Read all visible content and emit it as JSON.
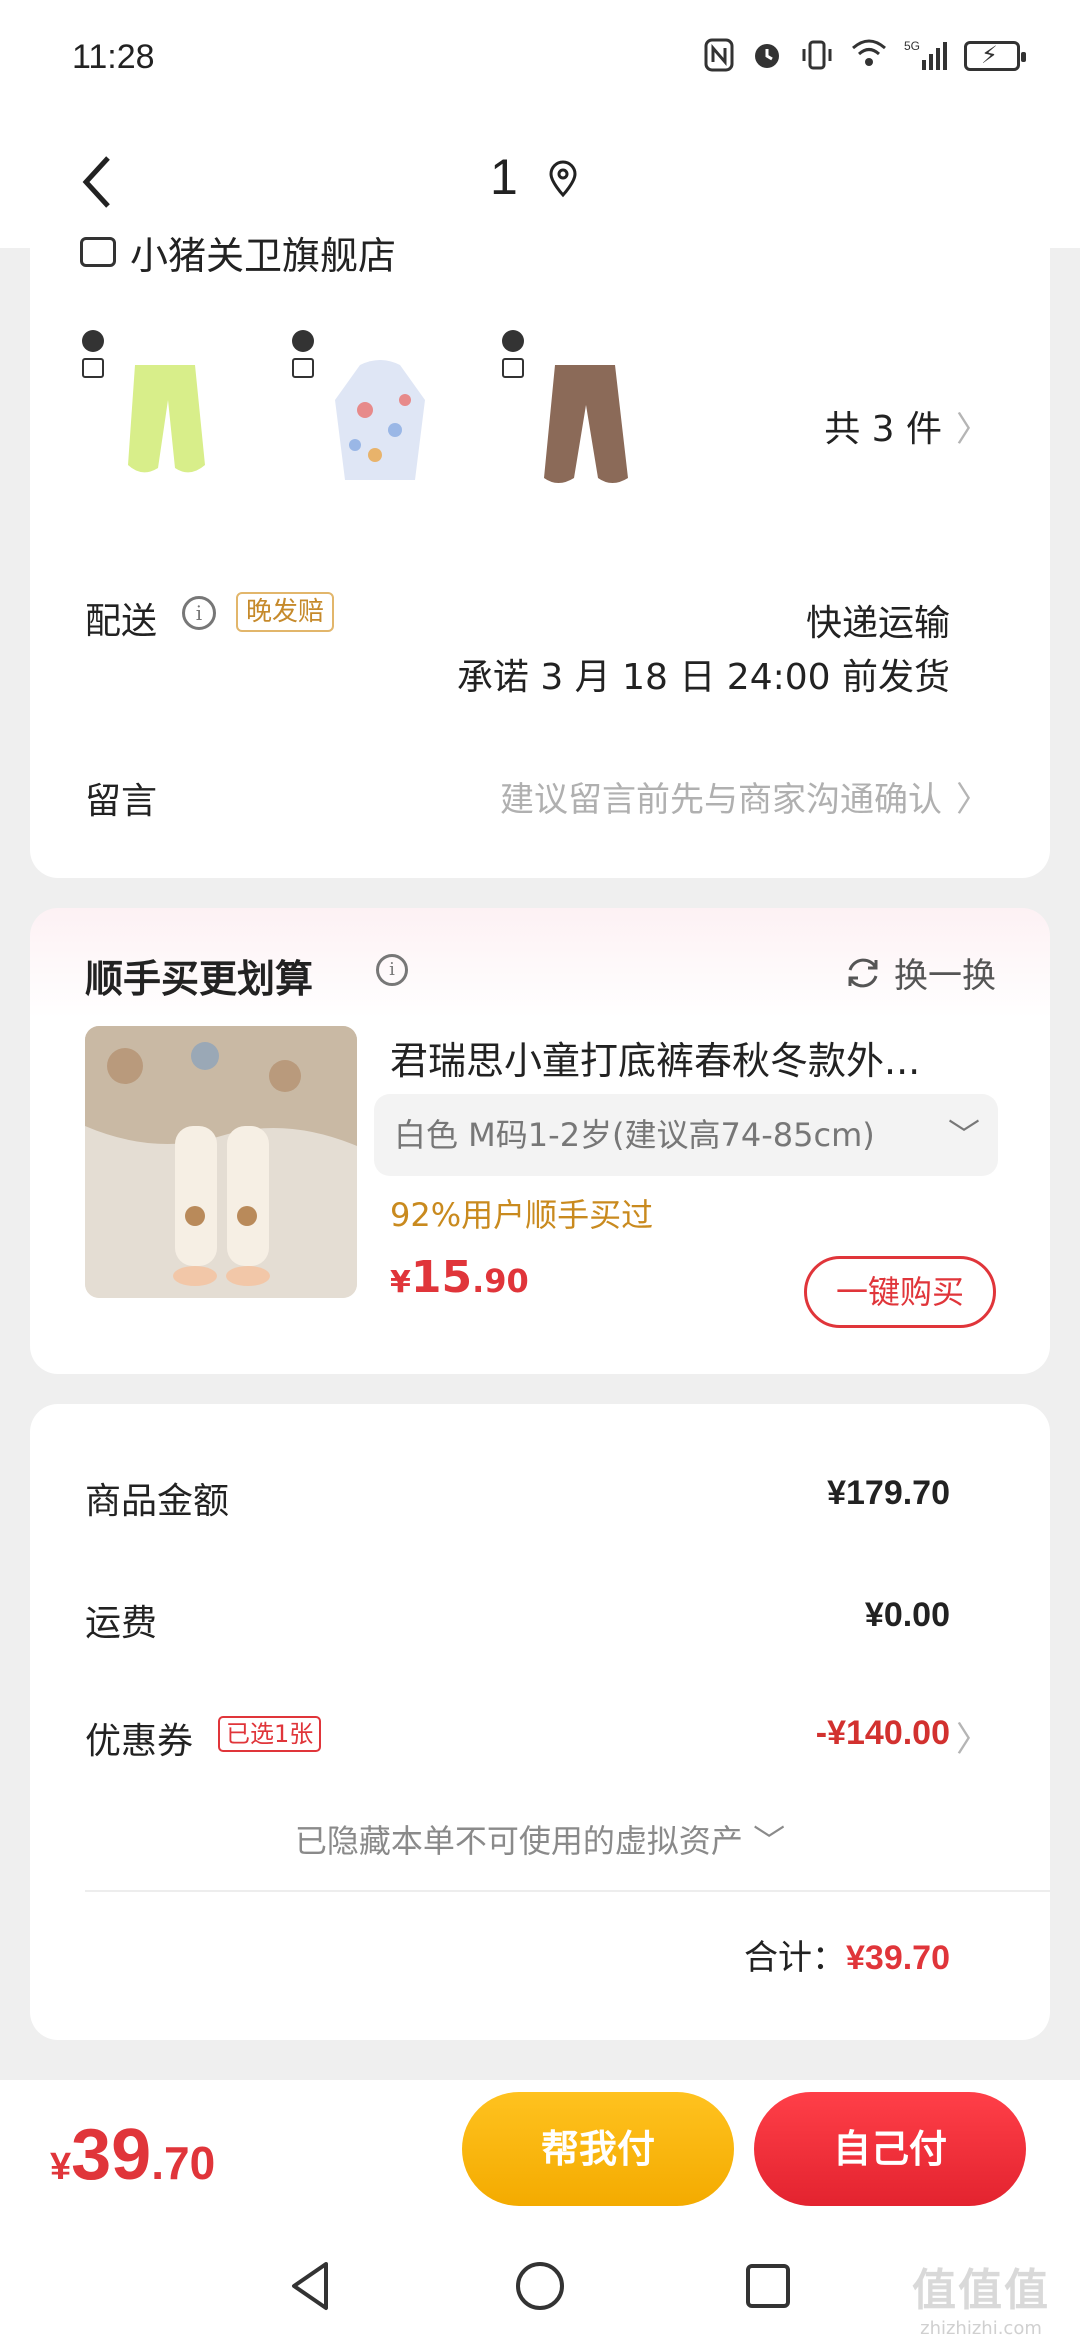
{
  "status_bar": {
    "time": "11:28",
    "network": "5G"
  },
  "header": {
    "title": "1"
  },
  "order": {
    "store_name": "小猪关卫旗舰店",
    "products": [
      {
        "color": "#d8ee8a"
      },
      {
        "color": "#dfe6f5"
      },
      {
        "color": "#8b6a58"
      }
    ],
    "item_count": "共 3 件",
    "delivery": {
      "label": "配送",
      "tag": "晚发赔",
      "method": "快递运输",
      "promise": "承诺 3 月 18 日 24:00 前发货"
    },
    "message": {
      "label": "留言",
      "placeholder": "建议留言前先与商家沟通确认"
    }
  },
  "recommendation": {
    "title": "顺手买更划算",
    "refresh_label": "换一换",
    "product_name": "君瑞思小童打底裤春秋冬款外...",
    "spec": "白色   M码1-2岁(建议高74-85cm)",
    "social_proof": "92%用户顺手买过",
    "price_yen": "¥",
    "price_int": "15",
    "price_dec": ".90",
    "buy_label": "一键购买"
  },
  "summary": {
    "goods_label": "商品金额",
    "goods_value": "¥179.70",
    "shipping_label": "运费",
    "shipping_value": "¥0.00",
    "coupon_label": "优惠券",
    "coupon_tag": "已选1张",
    "coupon_value": "-¥140.00",
    "hidden_assets": "已隐藏本单不可使用的虚拟资产",
    "subtotal_label": "合计：",
    "subtotal_value": "¥39.70"
  },
  "bottom_bar": {
    "price_yen": "¥",
    "price_int": "39",
    "price_dec": ".70",
    "pay_help_label": "帮我付",
    "pay_self_label": "自己付"
  },
  "watermark": {
    "big": "值值值",
    "small": "zhizhizhi.com"
  },
  "colors": {
    "accent_red": "#e0353a",
    "accent_yellow": "#f8b80d",
    "tag_orange": "#c68a2b"
  }
}
